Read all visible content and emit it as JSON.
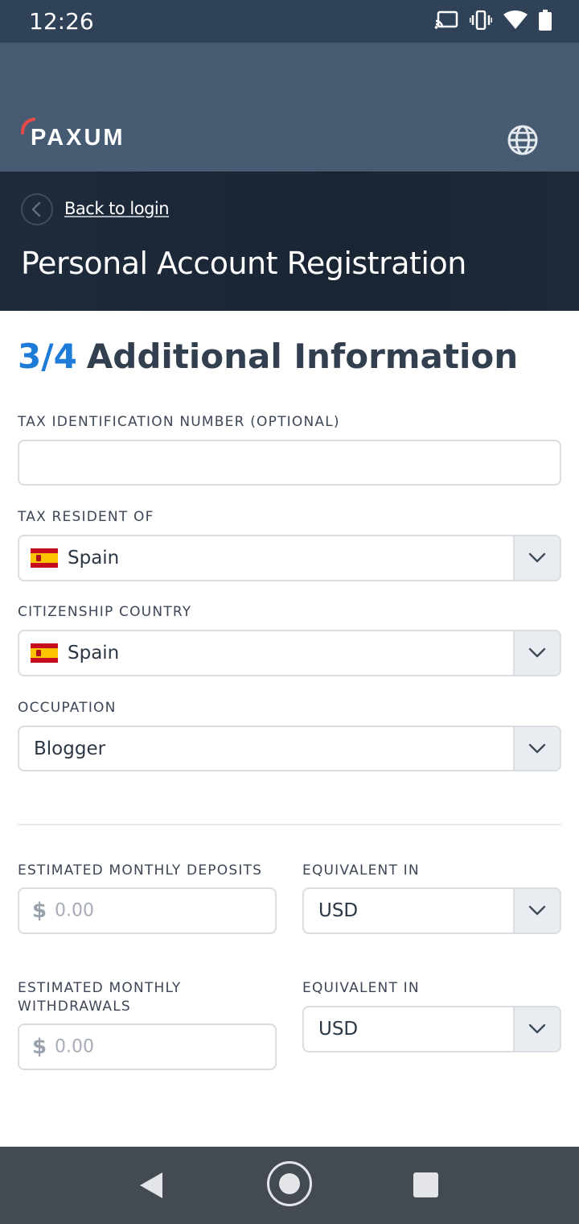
{
  "status_bar": {
    "time": "12:26",
    "icons": [
      "cast-icon",
      "vibrate-icon",
      "wifi-icon",
      "battery-icon"
    ]
  },
  "header": {
    "logo_text": "PAXUM",
    "globe_icon": "globe-icon",
    "accent_color": "#e84b4b"
  },
  "title_band": {
    "back_link": "Back to login",
    "page_title": "Personal Account Registration"
  },
  "form": {
    "step_number": "3/4",
    "step_title": "Additional Information",
    "tin": {
      "label": "TAX IDENTIFICATION NUMBER (OPTIONAL)",
      "value": ""
    },
    "tax_resident": {
      "label": "TAX RESIDENT OF",
      "value": "Spain"
    },
    "citizenship": {
      "label": "CITIZENSHIP COUNTRY",
      "value": "Spain"
    },
    "occupation": {
      "label": "OCCUPATION",
      "value": "Blogger"
    },
    "deposits": {
      "label": "ESTIMATED MONTHLY DEPOSITS",
      "currency_symbol": "$",
      "placeholder": "0.00",
      "equivalent_label": "EQUIVALENT IN",
      "currency": "USD"
    },
    "withdrawals": {
      "label_line1": "ESTIMATED MONTHLY",
      "label_line2": "WITHDRAWALS",
      "currency_symbol": "$",
      "placeholder": "0.00",
      "equivalent_label": "EQUIVALENT IN",
      "currency": "USD"
    }
  },
  "colors": {
    "step_accent": "#1f7bd8",
    "header_bg": "#475b73",
    "band_bg": "#1e2b3b"
  }
}
